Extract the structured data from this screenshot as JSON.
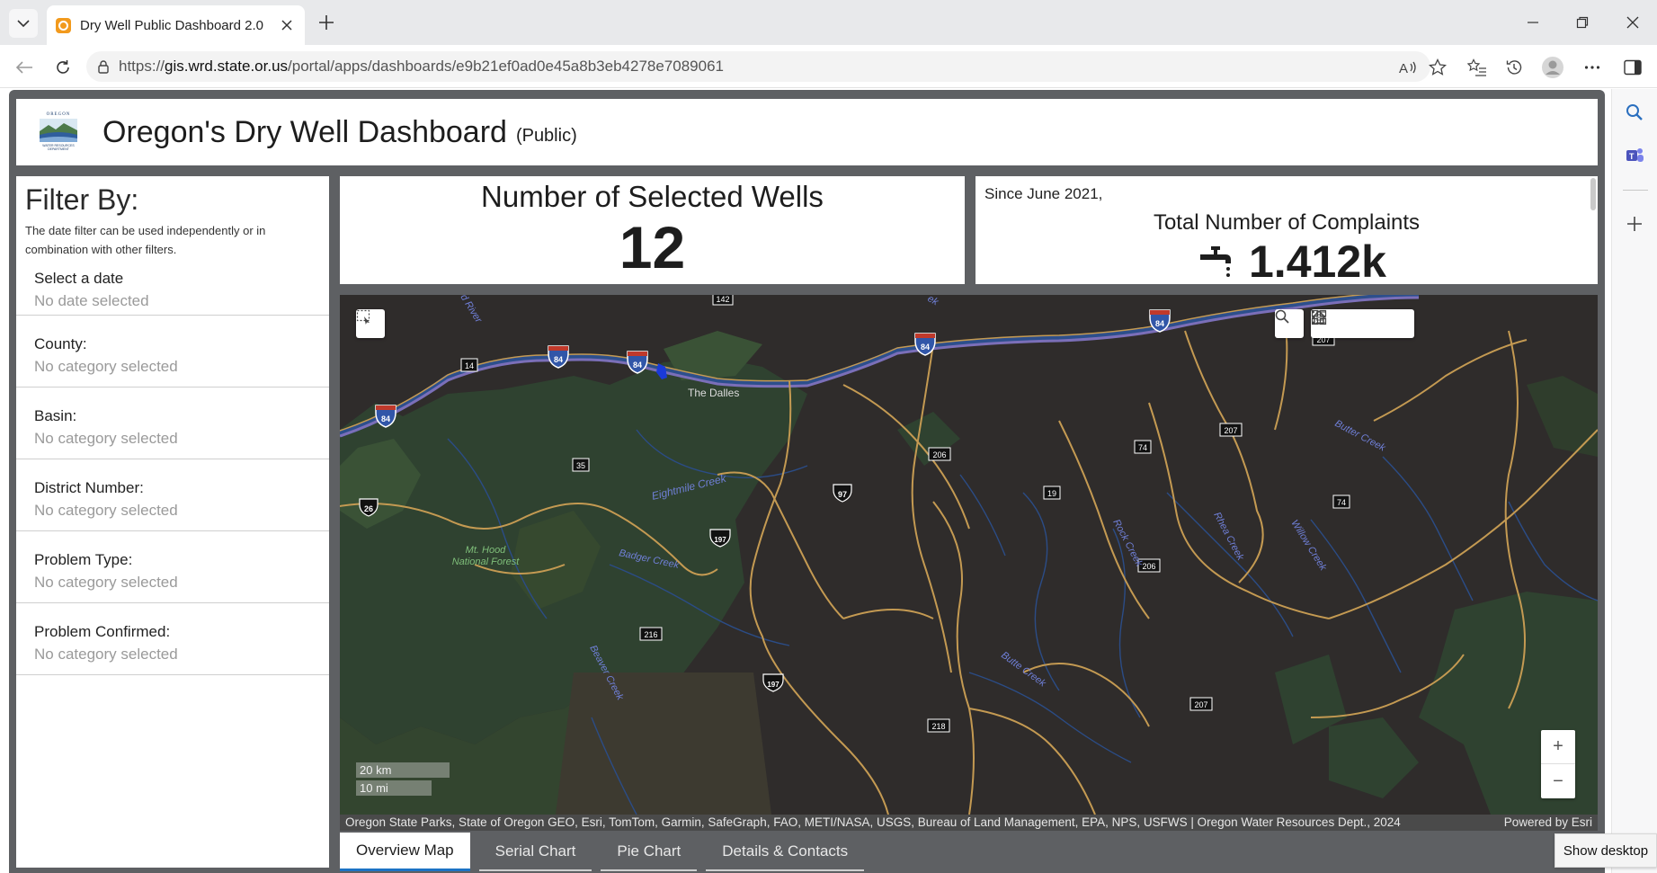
{
  "browser": {
    "tab_title": "Dry Well Public Dashboard 2.0",
    "url_prefix": "https://",
    "url_host": "gis.wrd.state.or.us",
    "url_path": "/portal/apps/dashboards/e9b21ef0ad0e45a8b3eb4278e7089061",
    "show_desktop": "Show desktop",
    "tab_list_icon": "chevron-down-icon",
    "close_tab_icon": "close-icon"
  },
  "header": {
    "logo_top": "OREGON",
    "logo_bottom": "WATER RESOURCES DEPARTMENT",
    "title": "Oregon's Dry Well Dashboard",
    "subtitle": "(Public)"
  },
  "filters": {
    "title": "Filter By:",
    "description": "The date filter can be used independently or in combination with other filters.",
    "items": [
      {
        "label": "Select a date",
        "value": "No date selected"
      },
      {
        "label": "County:",
        "value": "No category selected"
      },
      {
        "label": "Basin:",
        "value": "No category selected"
      },
      {
        "label": "District Number:",
        "value": "No category selected"
      },
      {
        "label": "Problem Type:",
        "value": "No category selected"
      },
      {
        "label": "Problem Confirmed:",
        "value": "No category selected"
      }
    ]
  },
  "stats": {
    "selected_wells_title": "Number of Selected Wells",
    "selected_wells_value": "12",
    "complaints_since": "Since June 2021,",
    "complaints_title": "Total Number of Complaints",
    "complaints_value": "1.412k"
  },
  "map": {
    "labels": {
      "the_dalles": "The Dalles",
      "eightmile_creek": "Eightmile Creek",
      "badger_creek": "Badger Creek",
      "mt_hood_1": "Mt. Hood",
      "mt_hood_2": "National Forest",
      "butter_creek": "Butter Creek",
      "rock_creek": "Rock Creek",
      "rhea_creek": "Rhea Creek",
      "willow_creek": "Willow Creek",
      "butte_creek": "Butte Creek",
      "beaver_creek": "Beaver Creek",
      "hood_river": "d River",
      "creek_top": "ek"
    },
    "shields": {
      "i84": "84",
      "us26": "26",
      "us97": "97",
      "us197": "197",
      "s14": "14",
      "s35": "35",
      "s142": "142",
      "s206": "206",
      "s216": "216",
      "s218": "218",
      "s207": "207",
      "s74": "74",
      "s19": "19"
    },
    "scale_km": "20 km",
    "scale_mi": "10 mi",
    "attribution": "Oregon State Parks, State of Oregon GEO, Esri, TomTom, Garmin, SafeGraph, FAO, METI/NASA, USGS, Bureau of Land Management, EPA, NPS, USFWS | Oregon Water Resources Dept., 2024",
    "powered_by": "Powered by Esri",
    "zoom_in": "+",
    "zoom_out": "−"
  },
  "tabs": [
    {
      "label": "Overview Map",
      "active": true
    },
    {
      "label": "Serial Chart",
      "active": false
    },
    {
      "label": "Pie Chart",
      "active": false
    },
    {
      "label": "Details & Contacts",
      "active": false
    }
  ],
  "colors": {
    "map_background": "#2f2c2b",
    "forest": "#2f4230",
    "road": "#c49a52",
    "interstate": "#7b6fb8",
    "water": "#2d4f8c",
    "tab_accent": "#1c73c5"
  }
}
